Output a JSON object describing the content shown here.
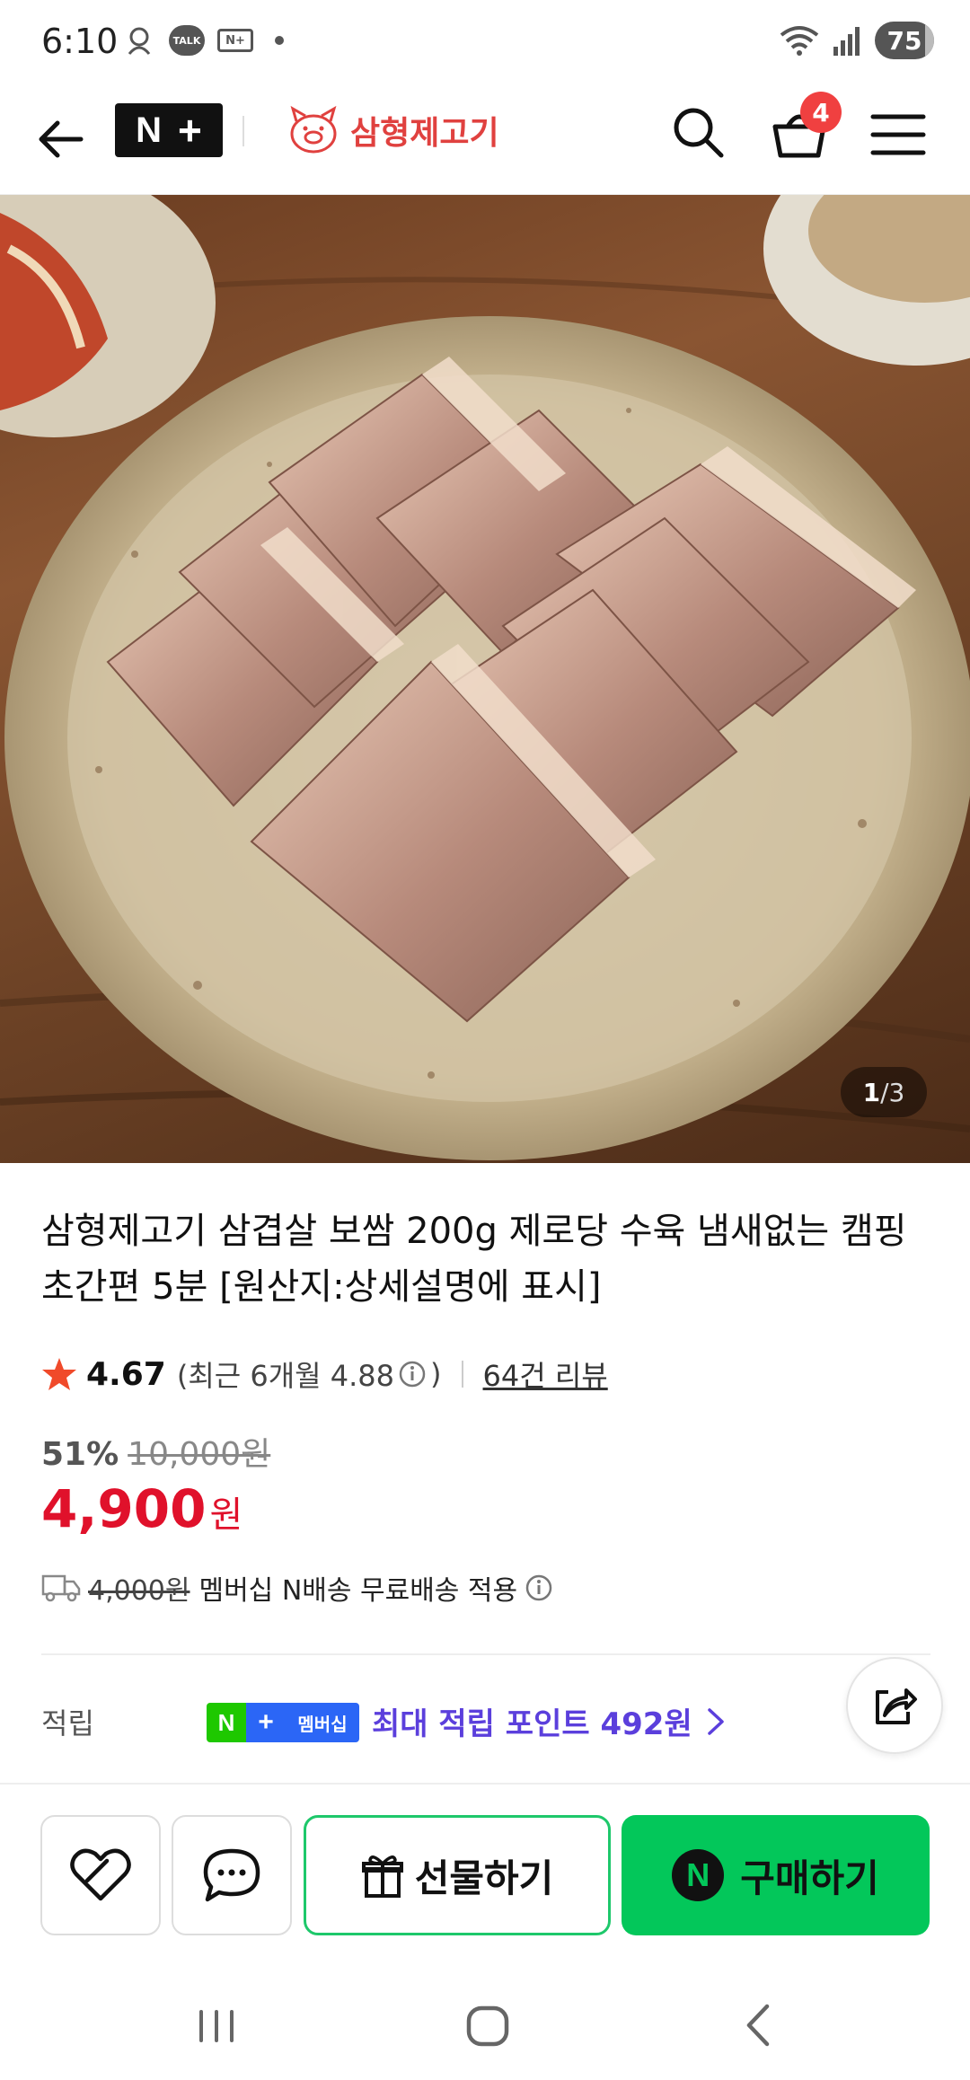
{
  "status_bar": {
    "time": "6:10",
    "talk_label": "TALK",
    "nplus_label": "N+",
    "battery": "75"
  },
  "header": {
    "logo_n": "N",
    "logo_plus": "+",
    "brand_name": "삼형제고기",
    "cart_count": "4"
  },
  "hero": {
    "page_current": "1",
    "page_sep": "/",
    "page_total": "3"
  },
  "product": {
    "title": "삼형제고기 삼겹살 보쌈 200g 제로당 수육 냄새없는 캠핑 초간편 5분 [원산지:상세설명에 표시]",
    "rating": "4.67",
    "recent_rating_prefix": "(최근 6개월 4.88",
    "recent_rating_suffix": ")",
    "review_count": "64건 리뷰",
    "discount_percent": "51%",
    "original_price": "10,000원",
    "price": "4,900",
    "price_unit": "원",
    "shipping_old": "4,000원",
    "shipping_text": "멤버십 N배송 무료배송 적용"
  },
  "reward": {
    "label": "적립",
    "badge_n": "N",
    "badge_plus": "+",
    "badge_text": "멤버십",
    "text": "최대 적립 포인트 492원"
  },
  "actions": {
    "gift_label": "선물하기",
    "buy_label": "구매하기",
    "buy_n": "N"
  },
  "colors": {
    "price_red": "#e0112b",
    "naver_green": "#03c75a",
    "reward_purple": "#5b3fdc",
    "badge_red": "#f04040"
  }
}
